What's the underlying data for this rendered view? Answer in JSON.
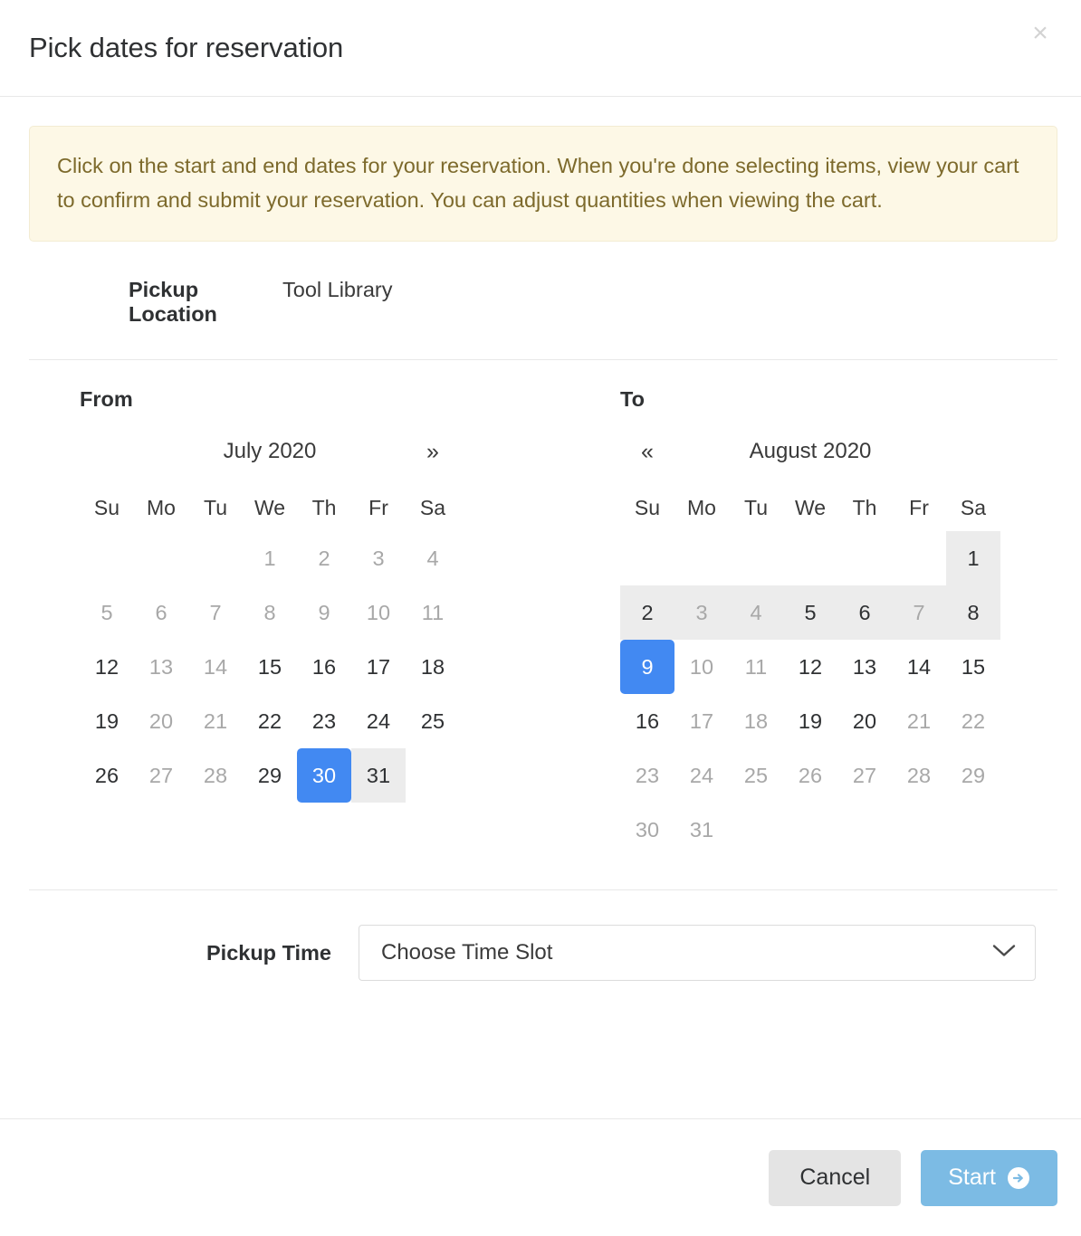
{
  "dialog": {
    "title": "Pick dates for reservation",
    "close_label": "×"
  },
  "alert": {
    "text": "Click on the start and end dates for your reservation. When you're done selecting items, view your cart to confirm and submit your reservation. You can adjust quantities when viewing the cart."
  },
  "pickup_location": {
    "label": "Pickup Location",
    "value": "Tool Library"
  },
  "calendars": {
    "from": {
      "heading": "From",
      "month_label": "July 2020",
      "prev_arrow": "«",
      "next_arrow": "»",
      "has_prev": false,
      "has_next": true,
      "weekdays": [
        "Su",
        "Mo",
        "Tu",
        "We",
        "Th",
        "Fr",
        "Sa"
      ],
      "weeks": [
        [
          {
            "day": "",
            "state": "empty"
          },
          {
            "day": "",
            "state": "empty"
          },
          {
            "day": "",
            "state": "empty"
          },
          {
            "day": "1",
            "state": "muted"
          },
          {
            "day": "2",
            "state": "muted"
          },
          {
            "day": "3",
            "state": "muted"
          },
          {
            "day": "4",
            "state": "muted"
          }
        ],
        [
          {
            "day": "5",
            "state": "muted"
          },
          {
            "day": "6",
            "state": "muted"
          },
          {
            "day": "7",
            "state": "muted"
          },
          {
            "day": "8",
            "state": "muted"
          },
          {
            "day": "9",
            "state": "muted"
          },
          {
            "day": "10",
            "state": "muted"
          },
          {
            "day": "11",
            "state": "muted"
          }
        ],
        [
          {
            "day": "12",
            "state": "available"
          },
          {
            "day": "13",
            "state": "muted"
          },
          {
            "day": "14",
            "state": "muted"
          },
          {
            "day": "15",
            "state": "available"
          },
          {
            "day": "16",
            "state": "available"
          },
          {
            "day": "17",
            "state": "available"
          },
          {
            "day": "18",
            "state": "available"
          }
        ],
        [
          {
            "day": "19",
            "state": "available"
          },
          {
            "day": "20",
            "state": "muted"
          },
          {
            "day": "21",
            "state": "muted"
          },
          {
            "day": "22",
            "state": "available"
          },
          {
            "day": "23",
            "state": "available"
          },
          {
            "day": "24",
            "state": "available"
          },
          {
            "day": "25",
            "state": "available"
          }
        ],
        [
          {
            "day": "26",
            "state": "available"
          },
          {
            "day": "27",
            "state": "muted"
          },
          {
            "day": "28",
            "state": "muted"
          },
          {
            "day": "29",
            "state": "available"
          },
          {
            "day": "30",
            "state": "selected"
          },
          {
            "day": "31",
            "state": "range-edge"
          },
          {
            "day": "",
            "state": "empty"
          }
        ]
      ]
    },
    "to": {
      "heading": "To",
      "month_label": "August 2020",
      "prev_arrow": "«",
      "next_arrow": "»",
      "has_prev": true,
      "has_next": false,
      "weekdays": [
        "Su",
        "Mo",
        "Tu",
        "We",
        "Th",
        "Fr",
        "Sa"
      ],
      "weeks": [
        [
          {
            "day": "",
            "state": "empty"
          },
          {
            "day": "",
            "state": "empty"
          },
          {
            "day": "",
            "state": "empty"
          },
          {
            "day": "",
            "state": "empty"
          },
          {
            "day": "",
            "state": "empty"
          },
          {
            "day": "",
            "state": "empty"
          },
          {
            "day": "1",
            "state": "range-edge"
          }
        ],
        [
          {
            "day": "2",
            "state": "in-range"
          },
          {
            "day": "3",
            "state": "in-range-muted"
          },
          {
            "day": "4",
            "state": "in-range-muted"
          },
          {
            "day": "5",
            "state": "in-range"
          },
          {
            "day": "6",
            "state": "in-range"
          },
          {
            "day": "7",
            "state": "in-range-muted"
          },
          {
            "day": "8",
            "state": "in-range"
          }
        ],
        [
          {
            "day": "9",
            "state": "selected"
          },
          {
            "day": "10",
            "state": "muted"
          },
          {
            "day": "11",
            "state": "muted"
          },
          {
            "day": "12",
            "state": "available"
          },
          {
            "day": "13",
            "state": "available"
          },
          {
            "day": "14",
            "state": "available"
          },
          {
            "day": "15",
            "state": "available"
          }
        ],
        [
          {
            "day": "16",
            "state": "available"
          },
          {
            "day": "17",
            "state": "muted"
          },
          {
            "day": "18",
            "state": "muted"
          },
          {
            "day": "19",
            "state": "available"
          },
          {
            "day": "20",
            "state": "available"
          },
          {
            "day": "21",
            "state": "muted"
          },
          {
            "day": "22",
            "state": "muted"
          }
        ],
        [
          {
            "day": "23",
            "state": "muted"
          },
          {
            "day": "24",
            "state": "muted"
          },
          {
            "day": "25",
            "state": "muted"
          },
          {
            "day": "26",
            "state": "muted"
          },
          {
            "day": "27",
            "state": "muted"
          },
          {
            "day": "28",
            "state": "muted"
          },
          {
            "day": "29",
            "state": "muted"
          }
        ],
        [
          {
            "day": "30",
            "state": "muted"
          },
          {
            "day": "31",
            "state": "muted"
          },
          {
            "day": "",
            "state": "empty"
          },
          {
            "day": "",
            "state": "empty"
          },
          {
            "day": "",
            "state": "empty"
          },
          {
            "day": "",
            "state": "empty"
          },
          {
            "day": "",
            "state": "empty"
          }
        ]
      ]
    }
  },
  "pickup_time": {
    "label": "Pickup Time",
    "selected": "Choose Time Slot"
  },
  "footer": {
    "cancel_label": "Cancel",
    "start_label": "Start"
  },
  "colors": {
    "selected_day": "#4289f2",
    "range_highlight": "#ececec",
    "alert_bg": "#fdf8e6",
    "alert_text": "#7d6a2c",
    "start_button": "#7cbbe4",
    "cancel_button": "#e4e4e4"
  }
}
